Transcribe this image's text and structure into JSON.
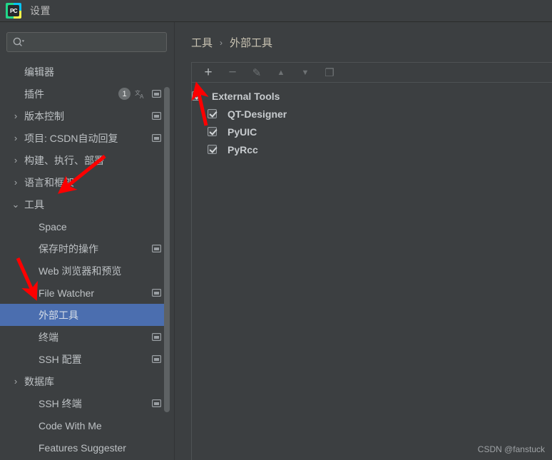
{
  "window": {
    "title": "设置",
    "app_icon": "pycharm-icon",
    "icon_text": "PC"
  },
  "search": {
    "value": "",
    "placeholder": "",
    "icon": "search-icon"
  },
  "sidebar": {
    "items": [
      {
        "label": "编辑器",
        "arrow": "",
        "indent": false,
        "badge": "",
        "translate": false,
        "window_icon": false,
        "selected": false
      },
      {
        "label": "插件",
        "arrow": "",
        "indent": false,
        "badge": "1",
        "translate": true,
        "window_icon": true,
        "selected": false
      },
      {
        "label": "版本控制",
        "arrow": "›",
        "indent": false,
        "badge": "",
        "translate": false,
        "window_icon": true,
        "selected": false
      },
      {
        "label": "项目: CSDN自动回复",
        "arrow": "›",
        "indent": false,
        "badge": "",
        "translate": false,
        "window_icon": true,
        "selected": false
      },
      {
        "label": "构建、执行、部署",
        "arrow": "›",
        "indent": false,
        "badge": "",
        "translate": false,
        "window_icon": false,
        "selected": false
      },
      {
        "label": "语言和框架",
        "arrow": "›",
        "indent": false,
        "badge": "",
        "translate": false,
        "window_icon": false,
        "selected": false
      },
      {
        "label": "工具",
        "arrow": "⌄",
        "indent": false,
        "badge": "",
        "translate": false,
        "window_icon": false,
        "selected": false
      },
      {
        "label": "Space",
        "arrow": "",
        "indent": true,
        "badge": "",
        "translate": false,
        "window_icon": false,
        "selected": false
      },
      {
        "label": "保存时的操作",
        "arrow": "",
        "indent": true,
        "badge": "",
        "translate": false,
        "window_icon": true,
        "selected": false
      },
      {
        "label": "Web 浏览器和预览",
        "arrow": "",
        "indent": true,
        "badge": "",
        "translate": false,
        "window_icon": false,
        "selected": false
      },
      {
        "label": "File Watcher",
        "arrow": "",
        "indent": true,
        "badge": "",
        "translate": false,
        "window_icon": true,
        "selected": false
      },
      {
        "label": "外部工具",
        "arrow": "",
        "indent": true,
        "badge": "",
        "translate": false,
        "window_icon": false,
        "selected": true
      },
      {
        "label": "终端",
        "arrow": "",
        "indent": true,
        "badge": "",
        "translate": false,
        "window_icon": true,
        "selected": false
      },
      {
        "label": "SSH 配置",
        "arrow": "",
        "indent": true,
        "badge": "",
        "translate": false,
        "window_icon": true,
        "selected": false
      },
      {
        "label": "数据库",
        "arrow": "›",
        "indent": false,
        "badge": "",
        "translate": false,
        "window_icon": false,
        "selected": false
      },
      {
        "label": "SSH 终端",
        "arrow": "",
        "indent": true,
        "badge": "",
        "translate": false,
        "window_icon": true,
        "selected": false
      },
      {
        "label": "Code With Me",
        "arrow": "",
        "indent": true,
        "badge": "",
        "translate": false,
        "window_icon": false,
        "selected": false
      },
      {
        "label": "Features Suggester",
        "arrow": "",
        "indent": true,
        "badge": "",
        "translate": false,
        "window_icon": false,
        "selected": false
      }
    ]
  },
  "breadcrumb": {
    "parent": "工具",
    "separator": "›",
    "current": "外部工具"
  },
  "toolbar": {
    "buttons": [
      {
        "name": "add-button",
        "glyph": "+",
        "disabled": false
      },
      {
        "name": "remove-button",
        "glyph": "−",
        "disabled": true
      },
      {
        "name": "edit-button",
        "glyph": "✎",
        "disabled": true
      },
      {
        "name": "move-up-button",
        "glyph": "▲",
        "disabled": true
      },
      {
        "name": "move-down-button",
        "glyph": "▼",
        "disabled": true
      },
      {
        "name": "copy-button",
        "glyph": "❐",
        "disabled": true
      }
    ]
  },
  "tools_list": [
    {
      "label": "External Tools",
      "checked": true,
      "child": false
    },
    {
      "label": "QT-Designer",
      "checked": true,
      "child": true
    },
    {
      "label": "PyUIC",
      "checked": true,
      "child": true
    },
    {
      "label": "PyRcc",
      "checked": true,
      "child": true
    }
  ],
  "watermark": "CSDN @fanstuck",
  "colors": {
    "background": "#3c3f41",
    "selection": "#4b6eaf",
    "text": "#bdc1c4",
    "breadcrumb": "#c9c3b2",
    "annotation_red": "#fe0000",
    "border": "#4e5254"
  }
}
